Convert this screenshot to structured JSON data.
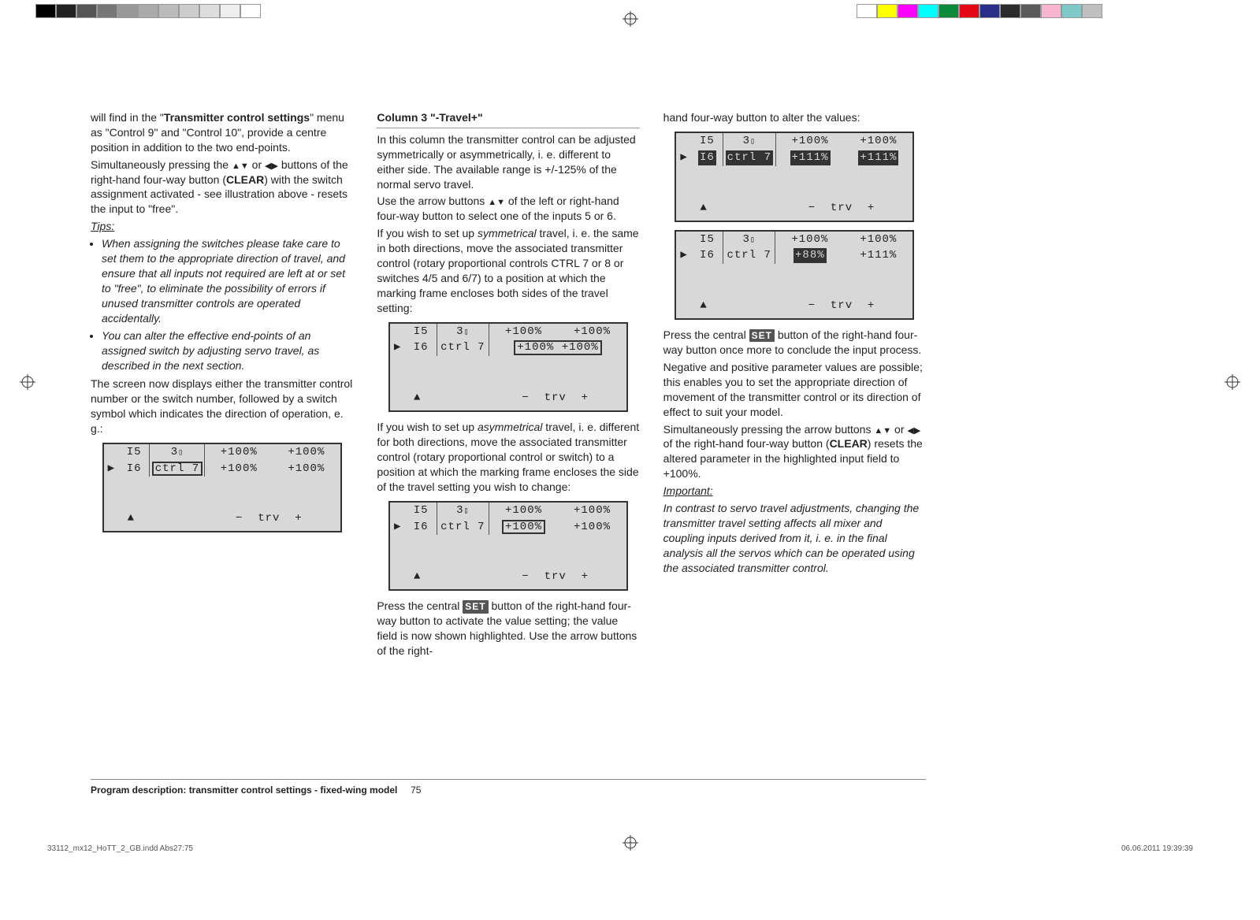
{
  "intro": {
    "p1a": "will find in the \"",
    "p1b": "Transmitter control settings",
    "p1c": "\" menu as \"Control 9\" and \"Control 10\", provide a centre position in addition to the two end-points.",
    "p2a": "Simultaneously pressing the ",
    "p2_arrows1": "▲▼",
    "p2_or": " or ",
    "p2_arrows2": "◀▶",
    "p2b": " buttons of the right-hand four-way button (",
    "p2_clear": "CLEAR",
    "p2c": ") with the switch assignment activated - see illustration above - resets the input to \"free\".",
    "tips_head": "Tips:",
    "tip1": "When assigning the switches please take care to set them to the appropriate direction of travel, and ensure that all inputs not required are left at or set to \"free\", to eliminate the possibility of errors if unused transmitter controls are operated accidentally.",
    "tip2": "You can alter the effective end-points of an assigned switch by adjusting servo travel, as described in the next section.",
    "p3": "The screen now displays either the transmitter control number or the switch number, followed by a switch symbol which indicates the direction of operation, e. g.:"
  },
  "col2": {
    "head": "Column 3 \"-Travel+\"",
    "p1": "In this column the transmitter control can be adjusted symmetrically or asymmetrically, i. e. different to either side. The available range is +/-125% of the normal servo travel.",
    "p2a": "Use the arrow buttons ",
    "p2_arrows": "▲▼",
    "p2b": " of the left or right-hand four-way button to select one of the inputs 5 or 6.",
    "p3a": "If you wish to set up ",
    "p3_sym": "symmetrical",
    "p3b": " travel, i. e. the same in both directions, move the associated transmitter control (rotary proportional controls CTRL 7 or 8 or switches 4/5 and 6/7) to a position at which the marking frame encloses both sides of the travel setting:",
    "p4a": "If you wish to set up ",
    "p4_asym": "asymmetrical",
    "p4b": " travel, i. e. different for both directions, move the associated transmitter control (rotary proportional control or switch) to a position at which the marking frame encloses the side of the travel setting you wish to change:",
    "p5a": "Press the central ",
    "p5_set": "SET",
    "p5b": " button of the right-hand four-way button to activate the value setting; the value field is now shown highlighted. Use the arrow buttons of the right-"
  },
  "col3": {
    "p0": "hand four-way button to alter the values:",
    "p1a": "Press the central ",
    "p1_set": "SET",
    "p1b": " button of the right-hand four-way button once more to conclude the input process.",
    "p2": "Negative and positive parameter values are possible; this enables you to set the appropriate direction of movement of the transmitter control or its direction of effect to suit your model.",
    "p3a": "Simultaneously pressing the arrow buttons ",
    "p3_arrows1": "▲▼",
    "p3_or": " or ",
    "p3_arrows2": "◀▶",
    "p3b": " of the right-hand four-way button (",
    "p3_clear": "CLEAR",
    "p3c": ") resets the altered parameter in the highlighted input field to +100%.",
    "imp_head": "Important:",
    "imp_body": "In contrast to servo travel adjustments, changing the transmitter travel setting affects all mixer and coupling inputs derived from it, i. e. in the final analysis all the servos which can be operated using the associated transmitter control."
  },
  "lcd_common": {
    "row1_i5": "I5",
    "row1_sw": "3",
    "row1_v1": "+100%",
    "row1_v2": "+100%",
    "row2_i6": "I6",
    "row2_ctrl": "ctrl 7",
    "scale": "−  trv  +",
    "scale_arrow": "▲"
  },
  "lcd1": {
    "v1": "+100%",
    "v2": "+100%",
    "cursor": "ctrl"
  },
  "lcd2": {
    "v1": "+100%",
    "v2": "+100%",
    "cursor": "both"
  },
  "lcd3": {
    "v1": "+100%",
    "v2": "+100%",
    "cursor": "left"
  },
  "lcd4": {
    "v1": "+111%",
    "v2": "+111%",
    "inv": "both"
  },
  "lcd5": {
    "v1": "+88%",
    "v2": "+111%",
    "inv": "left"
  },
  "footer": {
    "title": "Program description: transmitter control settings - fixed-wing model",
    "page": "75"
  },
  "meta": {
    "left": "33112_mx12_HoTT_2_GB.indd   Abs27:75",
    "right": "06.06.2011   19:39:39"
  }
}
